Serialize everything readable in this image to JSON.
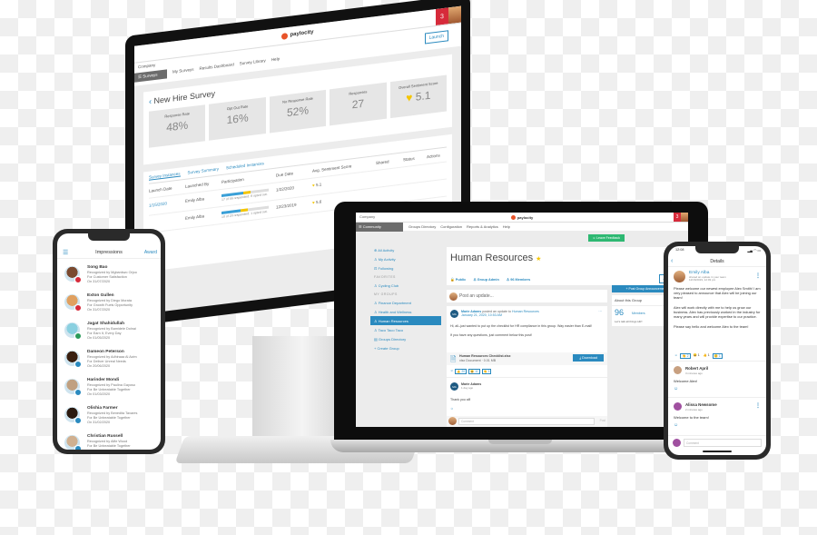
{
  "monitor": {
    "brand": "paylocity",
    "notification_count": "3",
    "company_label": "Company",
    "module_label": "Surveys",
    "nav_links": [
      "My Surveys",
      "Results Dashboard",
      "Survey Library",
      "Help"
    ],
    "launch_button": "Launch",
    "survey_title": "New Hire Survey",
    "stats": [
      {
        "label": "Response Rate",
        "value": "48%"
      },
      {
        "label": "Opt Out Rate",
        "value": "16%"
      },
      {
        "label": "No Response Rate",
        "value": "52%"
      },
      {
        "label": "Responses",
        "value": "27"
      },
      {
        "label": "Overall Sentiment Score",
        "value": "5.1"
      }
    ],
    "tabs": [
      "Survey Instances",
      "Survey Summary",
      "Scheduled Instances"
    ],
    "table_headers": [
      "Launch Date",
      "Launched By",
      "Participation",
      "Due Date",
      "Avg. Sentiment Score",
      "Shared",
      "Status",
      "Actions"
    ],
    "rows": [
      {
        "launch_date": "1/15/2020",
        "launched_by": "Emily Alba",
        "participation_pct": 0.62,
        "participation_label": "62%",
        "participation_note": "17 of 56 responded. 8 opted out.",
        "due_date": "1/22/2020",
        "score": "5.1"
      },
      {
        "launch_date": "",
        "launched_by": "Emily Alba",
        "participation_pct": 0.55,
        "participation_label": "55%",
        "participation_note": "10 of 20 responded. 1 opted out.",
        "due_date": "12/23/2019",
        "score": "5.6"
      }
    ]
  },
  "laptop": {
    "brand": "paylocity",
    "notification_count": "3",
    "company_label": "Company",
    "module_label": "Community",
    "nav_links": [
      "Groups Directory",
      "Configuration",
      "Reports & Analytics",
      "Help"
    ],
    "leave_button": "Leave Feedback",
    "sidebar": {
      "top": [
        "All Activity",
        "My Activity",
        "Following"
      ],
      "favorites_heading": "FAVORITES",
      "favorites": [
        "Cycling Club"
      ],
      "my_groups_heading": "MY GROUPS",
      "groups": [
        "Finance Department",
        "Health and Wellness",
        "Human Resources",
        "Taco Taco Taco"
      ],
      "active_group": "Human Resources",
      "footer": [
        "Groups Directory",
        "Create Group"
      ]
    },
    "group": {
      "title": "Human Resources",
      "visibility": "Public",
      "role": "Group Admin",
      "members_label": "96 Members",
      "actions_button": "Actions"
    },
    "post_placeholder": "Post an update...",
    "post": {
      "author_initials": "MA",
      "author": "Marie Adams",
      "action": "posted an update to",
      "target": "Human Resources",
      "timestamp": "January 21, 2020, 10:53 AM",
      "body_1": "Hi, all–just wanted to put up the checklist for HR compliance in this group. Way easier than E-mail!",
      "body_2": "If you have any questions, just comment below this post!",
      "attachment_name": "Human Resources Checklist.xlsx",
      "attachment_meta": "xlsx Document · 0.01 MB",
      "download_button": "Download",
      "reactions": [
        "👍 20",
        "😀 11",
        "👏 3"
      ],
      "comment": {
        "initials": "MA",
        "author": "Marie Adams",
        "time": "1 day ago",
        "text": "Thank you all!"
      },
      "comment_placeholder": "Comment",
      "post_button": "Post"
    },
    "announcement_button": "Post Group Announcement",
    "about": {
      "title": "About this Group",
      "count": "96",
      "count_label": "Members",
      "description": "Let's talk all things HR!"
    }
  },
  "phone_left": {
    "title": "Impressions",
    "award_button": "Award",
    "items": [
      {
        "name": "Song Bao",
        "by": "Recognized by Mgbankwo Orjoo",
        "for": "For Customer Satisfaction",
        "date": "On 31/07/2020",
        "color": "#7a4a30",
        "badge": "#d62a3a"
      },
      {
        "name": "Exton Gullen",
        "by": "Recognized by Diego Morata",
        "for": "For Growth Fuels Opportunity",
        "date": "On 31/07/2020",
        "color": "#e0a060",
        "badge": "#d62a3a"
      },
      {
        "name": "Jagat Shahidullah",
        "by": "Recognized by Bamidele Dolnai",
        "for": "For Earn It, Every Day",
        "date": "On 01/05/2020",
        "color": "#8ad0e0",
        "badge": "#2a9a5a"
      },
      {
        "name": "Dameon Peterson",
        "by": "Recognized by Adhiraaa Al Azim",
        "for": "For Deliver Unreal Needs",
        "date": "On 20/06/2020",
        "color": "#3a2010",
        "badge": "#2a8abf"
      },
      {
        "name": "Harinder Mondi",
        "by": "Recognized by Paulina Gayoso",
        "for": "For Be Unbeatable Together",
        "date": "On 01/03/2020",
        "color": "#c0a080",
        "badge": "#2a8abf"
      },
      {
        "name": "Olishia Farmer",
        "by": "Recognized by Benedita Tavares",
        "for": "For Be Unbeatable Together",
        "date": "On 31/02/2020",
        "color": "#2a1a10",
        "badge": "#2a8abf"
      },
      {
        "name": "Christian Russell",
        "by": "Recognized by Alfie Wood",
        "for": "For Be Unbeatable Together",
        "date": "",
        "color": "#d0b090",
        "badge": "#2a8abf"
      }
    ]
  },
  "phone_right": {
    "time": "12:08",
    "title": "Details",
    "author": "Emily Alba",
    "author_sub_1": "shared an update in your team",
    "author_sub_2": "12/16/2019, 12:03 pm",
    "body_1": "Please welcome our newest employee Alex Smith! I am very pleased to announce that Alex will be joining our team!",
    "body_2": "Alex will work directly with me to help us grow our business. Alex has previously worked in the industry for many years and will provide expertise to our practice.",
    "body_3": "Please say hello and welcome Alex to the team!",
    "reactions": [
      "👏 2",
      "😀 1",
      "👍 1",
      "😊 1"
    ],
    "comments": [
      {
        "author": "Robert April",
        "time": "3 minutes ago",
        "text": "Welcome Alex!",
        "color": "#c8a080"
      },
      {
        "author": "Alissa Newsome",
        "time": "2 minutes ago",
        "text": "Welcome to the team!",
        "color": "#a050a0"
      }
    ],
    "comment_placeholder": "Comment"
  }
}
